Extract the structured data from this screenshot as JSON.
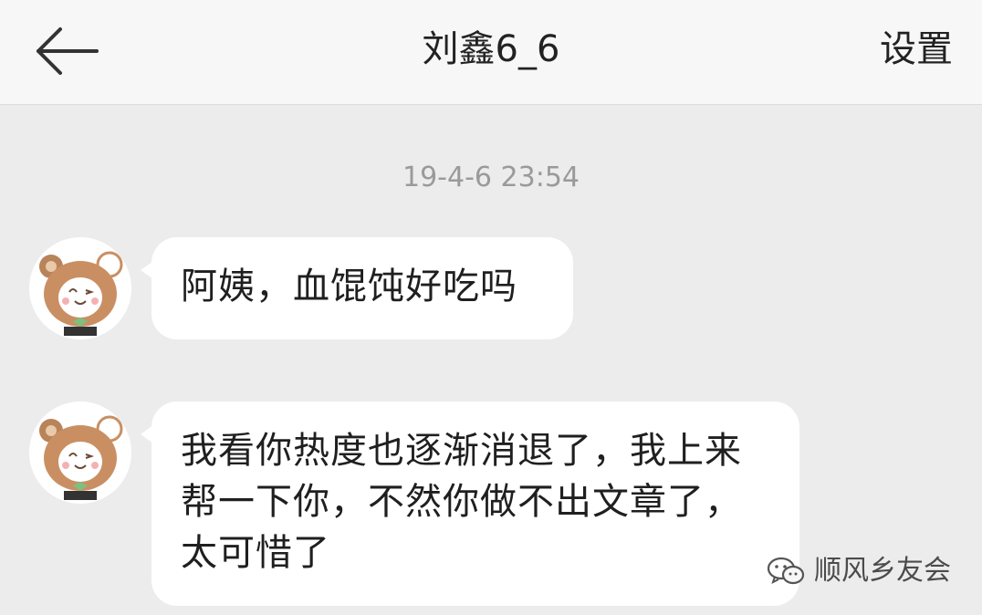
{
  "header": {
    "title": "刘鑫6_6",
    "settings_label": "设置"
  },
  "chat": {
    "timestamp": "19-4-6 23:54",
    "messages": [
      {
        "text": "阿姨，血馄饨好吃吗"
      },
      {
        "text": "我看你热度也逐渐消退了，我上来帮一下你，不然你做不出文章了，太可惜了"
      }
    ]
  },
  "watermark": {
    "text": "顺风乡友会"
  },
  "icons": {
    "back": "arrow-left-icon",
    "avatar": "bear-avatar-icon",
    "watermark": "wechat-icon"
  },
  "colors": {
    "header_bg": "#f7f7f7",
    "chat_bg": "#ececec",
    "bubble_bg": "#ffffff",
    "timestamp": "#9a9a9a"
  }
}
